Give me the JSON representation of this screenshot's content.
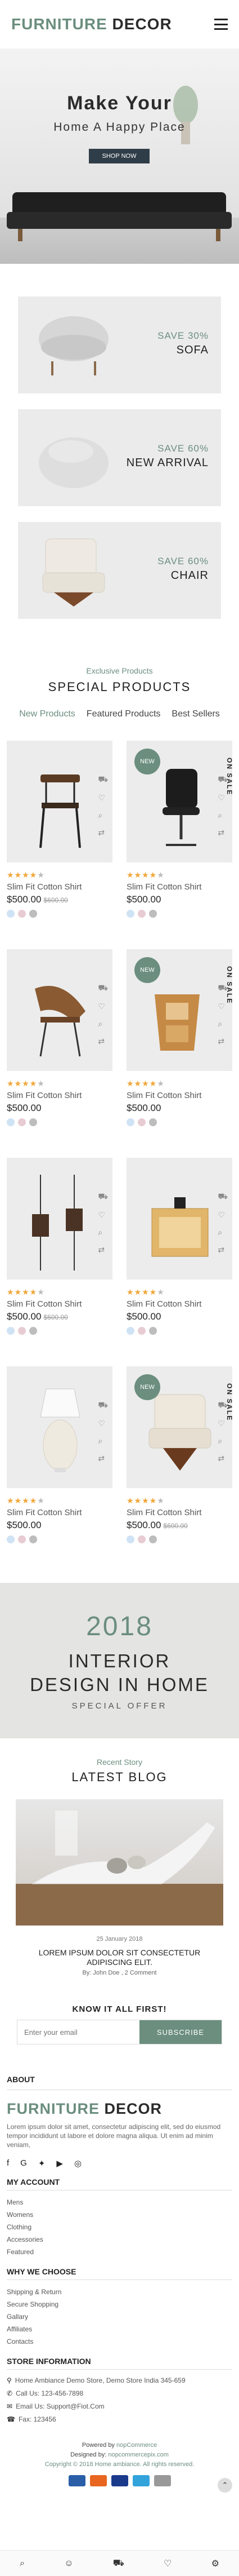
{
  "header": {
    "logo_part1": "FURNITURE",
    "logo_part2": "DECOR"
  },
  "hero": {
    "title": "Make Your",
    "subtitle": "Home A Happy Place",
    "button": "SHOP NOW"
  },
  "banners": [
    {
      "sale": "SAVE 30%",
      "name": "SOFA"
    },
    {
      "sale": "SAVE 60%",
      "name": "NEW ARRIVAL"
    },
    {
      "sale": "SAVE 60%",
      "name": "CHAIR"
    }
  ],
  "special": {
    "subtitle": "Exclusive Products",
    "title": "SPECIAL PRODUCTS",
    "tabs": [
      "New Products",
      "Featured Products",
      "Best Sellers"
    ]
  },
  "products": [
    {
      "name": "Slim Fit Cotton Shirt",
      "price": "$500.00",
      "old_price": "$600.00",
      "rating": 4,
      "badge": "",
      "onsale": "",
      "icon": "dining-chair"
    },
    {
      "name": "Slim Fit Cotton Shirt",
      "price": "$500.00",
      "old_price": "",
      "rating": 4,
      "badge": "NEW",
      "onsale": "ON SALE",
      "icon": "office-chair"
    },
    {
      "name": "Slim Fit Cotton Shirt",
      "price": "$500.00",
      "old_price": "",
      "rating": 4,
      "badge": "",
      "onsale": "",
      "icon": "lounge-chair"
    },
    {
      "name": "Slim Fit Cotton Shirt",
      "price": "$500.00",
      "old_price": "",
      "rating": 4,
      "badge": "NEW",
      "onsale": "ON SALE",
      "icon": "wooden-rack"
    },
    {
      "name": "Slim Fit Cotton Shirt",
      "price": "$500.00",
      "old_price": "$600.00",
      "rating": 4,
      "badge": "",
      "onsale": "",
      "icon": "lanterns"
    },
    {
      "name": "Slim Fit Cotton Shirt",
      "price": "$500.00",
      "old_price": "",
      "rating": 4,
      "badge": "",
      "onsale": "",
      "icon": "side-table"
    },
    {
      "name": "Slim Fit Cotton Shirt",
      "price": "$500.00",
      "old_price": "",
      "rating": 4,
      "badge": "",
      "onsale": "",
      "icon": "table-lamp"
    },
    {
      "name": "Slim Fit Cotton Shirt",
      "price": "$500.00",
      "old_price": "$600.00",
      "rating": 4,
      "badge": "NEW",
      "onsale": "ON SALE",
      "icon": "armchair"
    }
  ],
  "colors": {
    "accent": "#6b8e7e",
    "swatch1": "#cfe3f5",
    "swatch2": "#e8ccd3",
    "swatch3": "#bdbdbd",
    "star": "#f1a637"
  },
  "promo": {
    "year": "2018",
    "line1": "INTERIOR",
    "line2": "DESIGN IN HOME",
    "line3": "SPECIAL OFFER"
  },
  "blog": {
    "subtitle": "Recent Story",
    "title": "LATEST BLOG",
    "date": "25 January 2018",
    "post_title": "LOREM IPSUM DOLOR SIT CONSECTETUR ADIPISCING ELIT.",
    "author": "By: John Doe , 2 Comment"
  },
  "newsletter": {
    "title": "KNOW IT ALL FIRST!",
    "placeholder": "Enter your email",
    "button": "SUBSCRIBE"
  },
  "footer": {
    "about_title": "ABOUT",
    "logo_part1": "FURNITURE",
    "logo_part2": "DECOR",
    "description": "Lorem ipsum dolor sit amet, consectetur adipiscing elit, sed do eiusmod tempor incididunt ut labore et dolore magna aliqua. Ut enim ad minim veniam,",
    "account_title": "MY ACCOUNT",
    "account_links": [
      "Mens",
      "Womens",
      "Clothing",
      "Accessories",
      "Featured"
    ],
    "choose_title": "WHY WE CHOOSE",
    "choose_links": [
      "Shipping & Return",
      "Secure Shopping",
      "Gallary",
      "Affiliates",
      "Contacts"
    ],
    "store_title": "STORE INFORMATION",
    "address": "Home Ambiance Demo Store, Demo Store India 345-659",
    "phone": "Call Us: 123-456-7898",
    "email": "Email Us: Support@Fiot.Com",
    "fax": "Fax: 123456",
    "powered_prefix": "Powered by ",
    "powered": "nopCommerce",
    "designed_prefix": "Designed by: ",
    "designed": "nopcommercepix.com",
    "copyright": "Copyright © 2018 Home ambiance. All rights reserved."
  }
}
